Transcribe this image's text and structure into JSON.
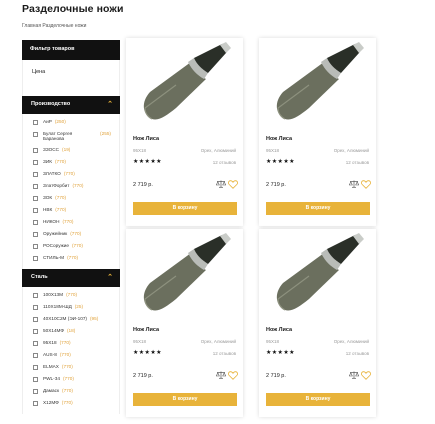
{
  "page": {
    "title": "Разделочные ножи",
    "breadcrumb": "Главная Разделочные ножи"
  },
  "sidebar": {
    "filter_title": "Фильтр товаров",
    "price_label": "Цена",
    "manufacturer": {
      "title": "Производство",
      "items": [
        {
          "label": "АиР",
          "count": "(250)"
        },
        {
          "label": "Булат Сергея Баранова",
          "count": "(255)"
        },
        {
          "label": "ЗЗОСС",
          "count": "(19)"
        },
        {
          "label": "ЗИК",
          "count": "(770)"
        },
        {
          "label": "ЗЛАТКО",
          "count": "(770)"
        },
        {
          "label": "ЗлатФорбит",
          "count": "(770)"
        },
        {
          "label": "ЗОК",
          "count": "(770)"
        },
        {
          "label": "НВК",
          "count": "(770)"
        },
        {
          "label": "НИКОН",
          "count": "(770)"
        },
        {
          "label": "Оружейник",
          "count": "(770)"
        },
        {
          "label": "РОСоружие",
          "count": "(770)"
        },
        {
          "label": "СТИЛЬ-М",
          "count": "(770)"
        }
      ]
    },
    "steel": {
      "title": "Сталь",
      "items": [
        {
          "label": "100Х13М",
          "count": "(770)"
        },
        {
          "label": "110Х18М-ШД",
          "count": "(25)"
        },
        {
          "label": "40Х10С2М (ЭИ-107)",
          "count": "(95)"
        },
        {
          "label": "50Х14МФ",
          "count": "(18)"
        },
        {
          "label": "95Х18",
          "count": "(770)"
        },
        {
          "label": "AUS-8",
          "count": "(770)"
        },
        {
          "label": "ELMAX",
          "count": "(770)"
        },
        {
          "label": "РWL-34",
          "count": "(770)"
        },
        {
          "label": "Дамаск",
          "count": "(770)"
        },
        {
          "label": "Х12МФ",
          "count": "(770)"
        }
      ]
    }
  },
  "products": [
    {
      "name": "Нож Лиса",
      "sku": "95Х18",
      "material": "Орех, Алюминий",
      "stars": "★★★★★",
      "reviews": "12 отзывов",
      "price": "2 719 р.",
      "button": "В корзину"
    },
    {
      "name": "Нож Лиса",
      "sku": "95Х18",
      "material": "Орех, Алюминий",
      "stars": "★★★★★",
      "reviews": "12 отзывов",
      "price": "2 719 р.",
      "button": "В корзину"
    },
    {
      "name": "Нож Лиса",
      "sku": "95Х18",
      "material": "Орех, Алюминий",
      "stars": "★★★★★",
      "reviews": "12 отзывов",
      "price": "2 719 р.",
      "button": "В корзину"
    },
    {
      "name": "Нож Лиса",
      "sku": "95Х18",
      "material": "Орех, Алюминий",
      "stars": "★★★★★",
      "reviews": "12 отзывов",
      "price": "2 719 р.",
      "button": "В корзину"
    }
  ],
  "colors": {
    "accent": "#e8b33a",
    "header_bg": "#111111",
    "blade": "#6b6f5e",
    "handle": "#2a2f28"
  },
  "icons": {
    "group_toggle": "chevron-up-icon",
    "compare": "scales-icon",
    "favorite": "heart-icon"
  }
}
